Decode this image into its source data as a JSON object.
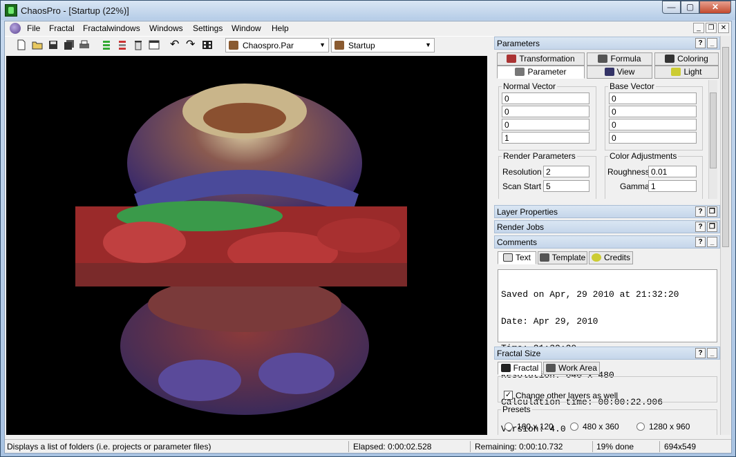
{
  "window": {
    "title": "ChaosPro - [Startup (22%)]",
    "min": "0",
    "max": "1",
    "close": "r"
  },
  "menu": {
    "items": [
      "File",
      "Fractal",
      "Fractalwindows",
      "Windows",
      "Settings",
      "Window",
      "Help"
    ]
  },
  "toolbar": {
    "parfile": "Chaospro.Par",
    "startup": "Startup"
  },
  "panels": {
    "parameters": {
      "title": "Parameters",
      "tabs_row1": [
        "Transformation",
        "Formula",
        "Coloring"
      ],
      "tabs_row2": [
        "Parameter",
        "View",
        "Light"
      ],
      "normal_vector": {
        "label": "Normal Vector",
        "values": [
          "0",
          "0",
          "0",
          "1"
        ]
      },
      "base_vector": {
        "label": "Base Vector",
        "values": [
          "0",
          "0",
          "0",
          "0"
        ]
      },
      "render_params": {
        "label": "Render Parameters",
        "resolution_label": "Resolution",
        "resolution": "2",
        "scan_start_label": "Scan Start",
        "scan_start": "5"
      },
      "color_adjust": {
        "label": "Color Adjustments",
        "roughness_label": "Roughness",
        "roughness": "0.01",
        "gamma_label": "Gamma",
        "gamma": "1"
      }
    },
    "layer_properties": {
      "title": "Layer Properties"
    },
    "render_jobs": {
      "title": "Render Jobs"
    },
    "comments": {
      "title": "Comments",
      "tabs": [
        "Text",
        "Template",
        "Credits"
      ],
      "lines": [
        "Saved on Apr, 29 2010 at 21:32:20",
        "Date: Apr 29, 2010",
        "Time: 21:32:20",
        "Resolution: 640 x 480",
        "Calculation time: 00:00:22.906",
        "Version: 4.0"
      ]
    },
    "fractal_size": {
      "title": "Fractal Size",
      "tabs": [
        "Fractal",
        "Work Area"
      ],
      "checkbox": "Change other layers as well",
      "checked": "✓",
      "presets_label": "Presets",
      "presets": [
        "160 x 120",
        "480 x 360",
        "1280 x 960"
      ]
    }
  },
  "status": {
    "message": "Displays a list of folders (i.e. projects or parameter files)",
    "elapsed": "Elapsed: 0:00:02.528",
    "remaining": "Remaining: 0:00:10.732",
    "done": "19% done",
    "size": "694x549"
  }
}
